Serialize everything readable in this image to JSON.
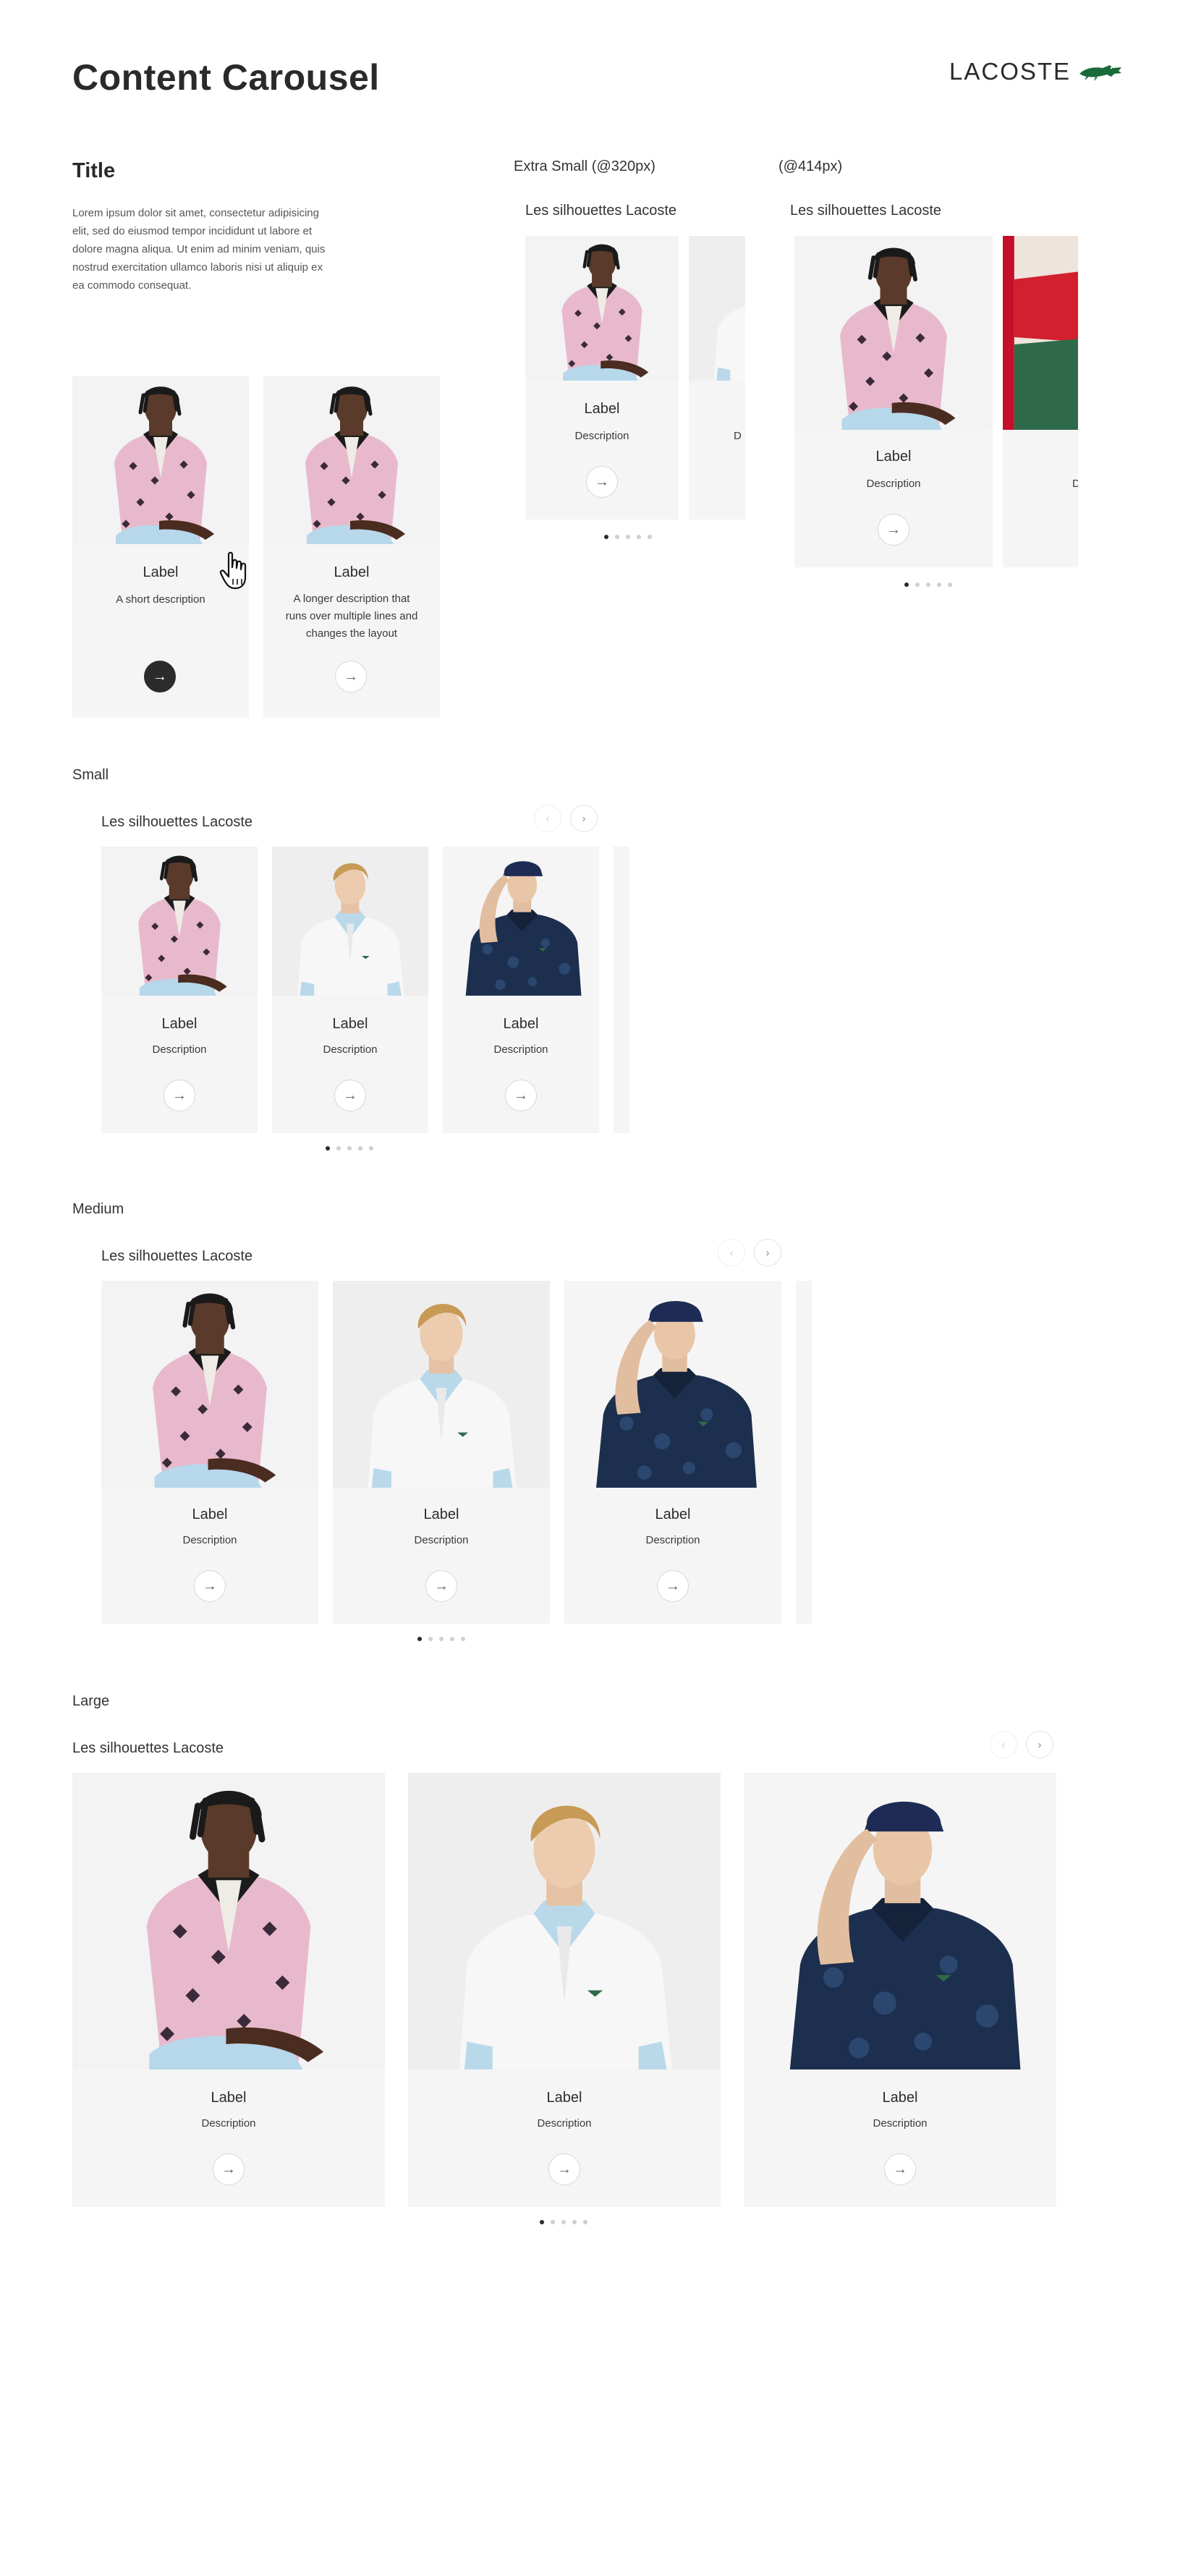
{
  "page": {
    "title": "Content Carousel",
    "brand": "LACOSTE",
    "logo_icon": "crocodile-logo-icon"
  },
  "intro": {
    "title": "Title",
    "body": "Lorem ipsum dolor sit amet, consectetur adipisicing elit, sed do eiusmod tempor incididunt ut labore et dolore magna aliqua. Ut enim ad minim veniam, quis nostrud exercitation ullamco laboris nisi ut aliquip ex ea commodo consequat."
  },
  "demo_cards": [
    {
      "label": "Label",
      "description": "A short description",
      "arrow_state": "hover"
    },
    {
      "label": "Label",
      "description": "A longer description that runs over multiple lines and changes the layout",
      "arrow_state": "default"
    }
  ],
  "xs_320": {
    "heading": "Extra Small (@320px)",
    "carousel_title": "Les silhouettes Lacoste",
    "card": {
      "label": "Label",
      "description": "Description"
    },
    "peek_desc": "D",
    "dots": 5,
    "active_dot": 1
  },
  "xs_414": {
    "heading": "(@414px)",
    "carousel_title": "Les silhouettes Lacoste",
    "card": {
      "label": "Label",
      "description": "Description"
    },
    "peek_desc": "D",
    "dots": 5,
    "active_dot": 1
  },
  "small": {
    "heading": "Small",
    "carousel_title": "Les silhouettes Lacoste",
    "cards": [
      {
        "label": "Label",
        "description": "Description"
      },
      {
        "label": "Label",
        "description": "Description"
      },
      {
        "label": "Label",
        "description": "Description"
      }
    ],
    "dots": 5,
    "active_dot": 1
  },
  "medium": {
    "heading": "Medium",
    "carousel_title": "Les silhouettes Lacoste",
    "cards": [
      {
        "label": "Label",
        "description": "Description"
      },
      {
        "label": "Label",
        "description": "Description"
      },
      {
        "label": "Label",
        "description": "Description"
      }
    ],
    "dots": 5,
    "active_dot": 1
  },
  "large": {
    "heading": "Large",
    "carousel_title": "Les silhouettes Lacoste",
    "cards": [
      {
        "label": "Label",
        "description": "Description"
      },
      {
        "label": "Label",
        "description": "Description"
      },
      {
        "label": "Label",
        "description": "Description"
      }
    ],
    "dots": 5,
    "active_dot": 1
  },
  "icons": {
    "arrow": "→",
    "prev": "‹",
    "next": "›"
  },
  "colors": {
    "card_bg": "#f5f5f5",
    "text_dark": "#2b2b2b",
    "brand_green": "#1b6b3a",
    "polo_pink": "#e8b9cc",
    "polo_white": "#f4f4f4",
    "polo_navy": "#1d2f4e",
    "collar_blue": "#b9d9ea"
  }
}
